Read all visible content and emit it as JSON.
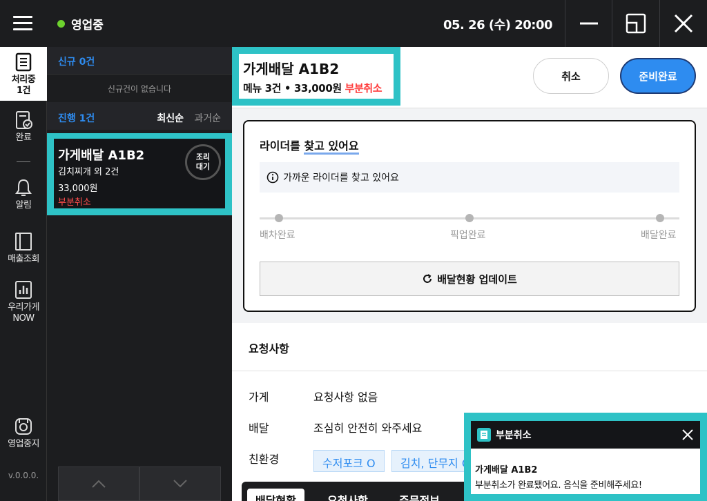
{
  "topbar": {
    "status": "영업중",
    "datetime": "05. 26 (수) 20:00"
  },
  "leftnav": {
    "items": [
      {
        "label": "처리중",
        "sub": "1건"
      },
      {
        "label": "완료"
      },
      {
        "label": "알림"
      },
      {
        "label": "매출조회"
      },
      {
        "label": "우리가게",
        "sub": "NOW"
      },
      {
        "label": "영업중지"
      }
    ],
    "version": "v.0.0.0."
  },
  "orders": {
    "new_header": "신규 0건",
    "empty_note": "신규건이 없습니다",
    "progress_header": "진행 1건",
    "sort_latest": "최신순",
    "sort_oldest": "과거순",
    "card": {
      "title": "가게배달 A1B2",
      "menu": "김치찌개 외 2건",
      "price": "33,000원",
      "status": "부분취소",
      "badge_line1": "조리",
      "badge_line2": "대기"
    }
  },
  "detail": {
    "title": "가게배달 A1B2",
    "subtitle": "메뉴 3건 • 33,000원",
    "subtitle_status": "부분취소",
    "cancel_label": "취소",
    "ready_label": "준비완료"
  },
  "rider": {
    "title_prefix": "라이더를 ",
    "title_highlight": "찾고 있어요",
    "info": "가까운 라이더를 찾고 있어요",
    "steps": [
      "배차완료",
      "픽업완료",
      "배달완료"
    ],
    "update_label": "배달현황 업데이트"
  },
  "requests": {
    "title": "요청사항",
    "rows": [
      {
        "label": "가게",
        "value": "요청사항 없음"
      },
      {
        "label": "배달",
        "value": "조심히 안전히 와주세요"
      },
      {
        "label": "친환경"
      }
    ],
    "chips": [
      "수저포크 O",
      "김치, 단무지 O"
    ]
  },
  "tabs": [
    "배달현황",
    "요청사항",
    "주문정보"
  ],
  "toast": {
    "title": "부분취소",
    "body_title": "가게배달 A1B2",
    "body_msg": "부분취소가 완료됐어요. 음식을 준비해주세요!"
  },
  "colors": {
    "accent": "#2ec2c6",
    "primary": "#2e8cf0",
    "danger": "#ff3d3d",
    "online": "#6dd22e"
  }
}
